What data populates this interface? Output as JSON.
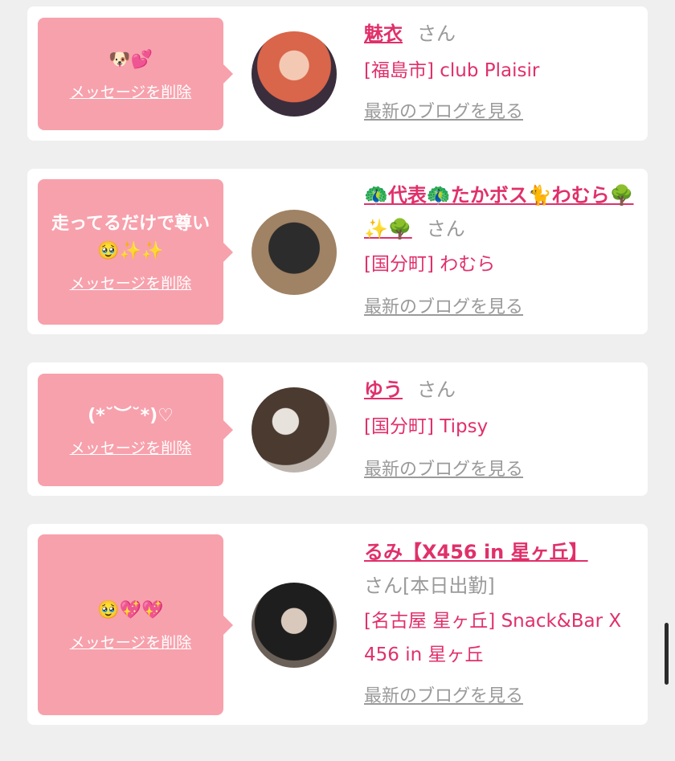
{
  "delete_label": "メッセージを削除",
  "blog_label": "最新のブログを見る",
  "san_label": "さん",
  "colors": {
    "accent": "#e0306a",
    "bubble": "#f7a1ac",
    "gray": "#9a9a9a"
  },
  "items": [
    {
      "message": "🐶💕",
      "name": "魅衣",
      "shop": "[福島市] club Plaisir"
    },
    {
      "message": "走ってるだけで尊い🥹✨✨",
      "name": "🦚代表🦚たかボス🐈わむら🌳✨🌳",
      "shop": "[国分町] わむら"
    },
    {
      "message": "(*˘︶˘*)♡",
      "name": "ゆう",
      "shop": "[国分町] Tipsy"
    },
    {
      "message": "🥹💖💖",
      "name": "るみ【X456 in 星ヶ丘】",
      "san_suffix": "[本日出勤]",
      "shop": "[名古屋 星ヶ丘] Snack&Bar X 456 in 星ヶ丘"
    }
  ]
}
